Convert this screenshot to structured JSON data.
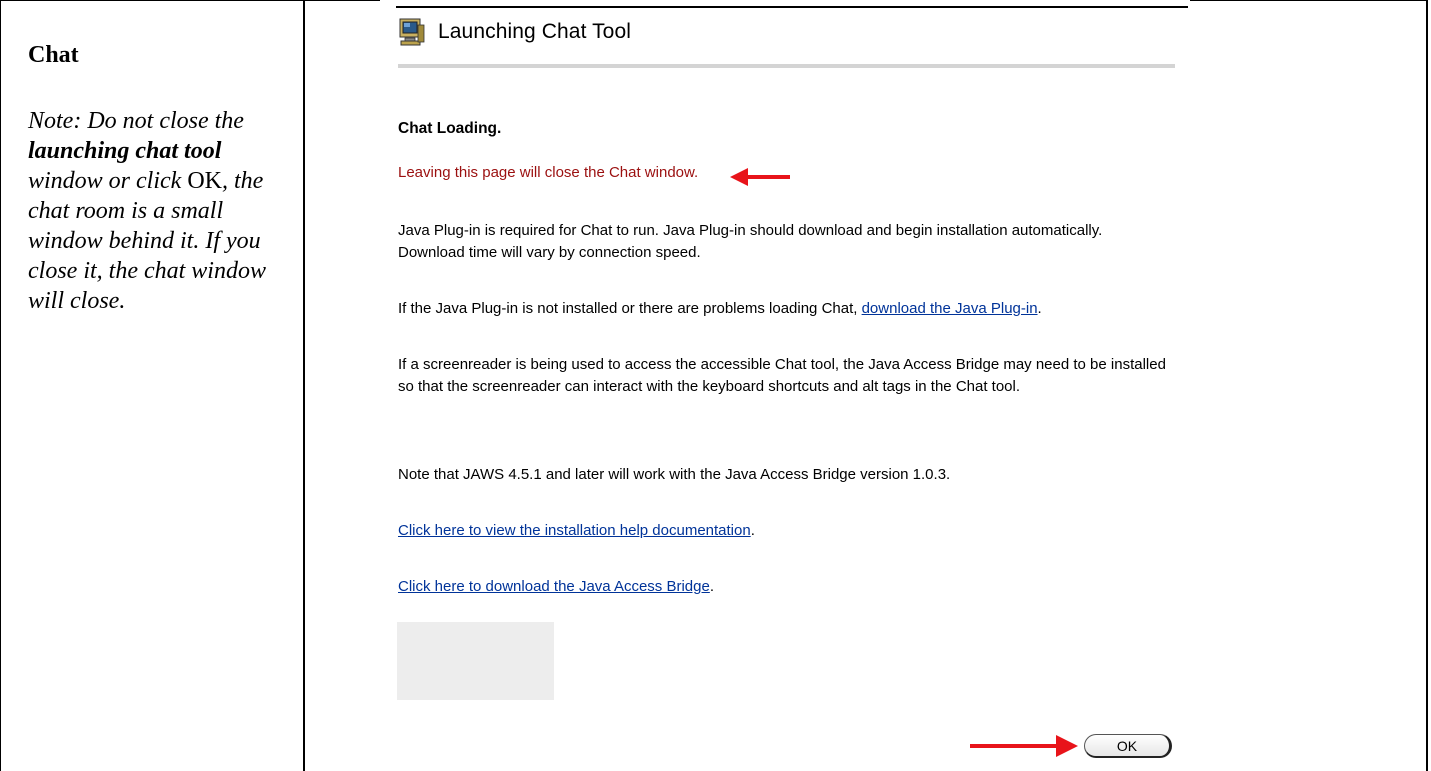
{
  "left_note": {
    "title": "Chat",
    "note_prefix": "Note: Do not close the ",
    "note_bold": "launching chat tool",
    "note_mid": " window or click ",
    "note_ok": "OK",
    "note_suffix": ", the chat room is a small window behind it. If you close it, the chat window will close."
  },
  "window": {
    "title": "Launching Chat Tool",
    "icon": "computer-icon"
  },
  "content": {
    "heading": "Chat Loading.",
    "warning": "Leaving this page will close the Chat window.",
    "para1": "Java Plug-in is required for Chat to run.   Java Plug-in should download and begin installation automatically. Download time will vary by connection speed.",
    "para2_prefix": "If the Java Plug-in is not installed or there are problems loading Chat, ",
    "para2_link": "download the Java Plug-in",
    "para2_suffix": ".",
    "para3": "If a screenreader is being used to access the accessible Chat tool, the Java Access Bridge may need to be installed so that the screenreader can interact with the keyboard shortcuts and alt tags in the Chat tool.",
    "para4": "Note that JAWS 4.5.1 and later will work with the Java Access Bridge version 1.0.3.",
    "link_help": "Click here to view the installation help documentation",
    "link_help_suffix": ".",
    "link_bridge": "Click here to download the Java Access Bridge",
    "link_bridge_suffix": "."
  },
  "ok_button": {
    "label": "OK"
  },
  "colors": {
    "warning": "#9b1010",
    "link": "#003399",
    "arrow": "#e8141a"
  }
}
